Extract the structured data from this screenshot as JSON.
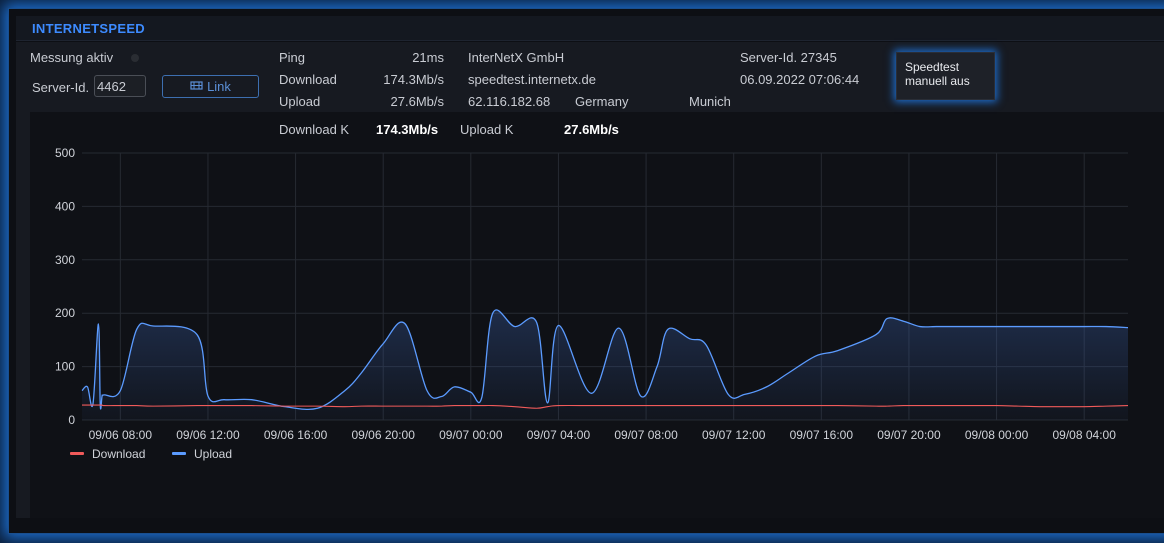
{
  "header": {
    "title": "INTERNETSPEED"
  },
  "controls": {
    "measurement_label": "Messung aktiv",
    "server_id_label": "Server-Id.",
    "server_id_value": "4462",
    "link_label": "Link",
    "speedtest_button": "Speedtest manuell aus"
  },
  "stats": {
    "ping_label": "Ping",
    "ping_value": "21ms",
    "download_label": "Download",
    "download_value": "174.3Mb/s",
    "upload_label": "Upload",
    "upload_value": "27.6Mb/s",
    "download_k_label": "Download K",
    "download_k_value": "174.3Mb/s",
    "upload_k_label": "Upload K",
    "upload_k_value": "27.6Mb/s"
  },
  "server_info": {
    "provider": "InterNetX GmbH",
    "host": "speedtest.internetx.de",
    "ip": "62.116.182.68",
    "country": "Germany",
    "city": "Munich",
    "server_id": "Server-Id. 27345",
    "timestamp": "06.09.2022 07:06:44"
  },
  "colors": {
    "accent": "#3d8bff",
    "download": "#f05a5a",
    "upload": "#5b9bff"
  },
  "chart_data": {
    "type": "area",
    "x": [
      "09/06 06:15",
      "09/06 06:30",
      "09/06 06:45",
      "09/06 07:00",
      "09/06 07:05",
      "09/06 07:10",
      "09/06 07:15",
      "09/06 08:00",
      "09/06 08:45",
      "09/06 09:30",
      "09/06 11:30",
      "09/06 12:00",
      "09/06 12:45",
      "09/06 14:00",
      "09/06 15:30",
      "09/06 17:00",
      "09/06 18:15",
      "09/06 19:00",
      "09/06 20:00",
      "09/06 21:00",
      "09/06 22:00",
      "09/06 22:40",
      "09/06 23:15",
      "09/07 00:00",
      "09/07 00:30",
      "09/07 01:00",
      "09/07 02:00",
      "09/07 03:00",
      "09/07 03:30",
      "09/07 04:00",
      "09/07 05:30",
      "09/07 06:45",
      "09/07 07:45",
      "09/07 08:30",
      "09/07 09:00",
      "09/07 10:00",
      "09/07 10:45",
      "09/07 11:45",
      "09/07 12:30",
      "09/07 13:30",
      "09/07 14:30",
      "09/07 15:45",
      "09/07 16:45",
      "09/07 18:30",
      "09/07 19:00",
      "09/07 19:45",
      "09/07 20:30",
      "09/07 21:15",
      "09/07 22:00",
      "09/07 23:00",
      "09/08 00:00",
      "09/08 01:00",
      "09/08 02:00",
      "09/08 03:00",
      "09/08 04:00",
      "09/08 05:00",
      "09/08 06:00"
    ],
    "series": [
      {
        "name": "Download",
        "values": [
          28,
          28,
          28,
          28,
          28,
          28,
          27,
          27,
          27,
          26,
          27,
          27,
          27,
          27,
          26,
          26,
          25,
          26,
          26,
          26,
          26,
          26,
          27,
          27,
          27,
          27,
          25,
          22,
          25,
          27,
          27,
          27,
          27,
          27,
          27,
          27,
          27,
          27,
          27,
          27,
          27,
          27,
          27,
          26,
          26,
          27,
          27,
          27,
          27,
          27,
          27,
          26,
          25,
          25,
          25,
          26,
          27
        ]
      },
      {
        "name": "Upload",
        "values": [
          55,
          62,
          30,
          180,
          28,
          45,
          47,
          55,
          170,
          176,
          160,
          45,
          38,
          38,
          25,
          22,
          55,
          88,
          143,
          180,
          55,
          44,
          62,
          52,
          42,
          200,
          175,
          183,
          32,
          177,
          50,
          172,
          45,
          100,
          170,
          152,
          140,
          48,
          48,
          62,
          88,
          120,
          130,
          160,
          190,
          185,
          175,
          175,
          175,
          175,
          175,
          175,
          175,
          175,
          175,
          175,
          173
        ]
      }
    ],
    "ylim": [
      0,
      500
    ],
    "yticks": [
      0,
      100,
      200,
      300,
      400,
      500
    ],
    "xticks": [
      "09/06 08:00",
      "09/06 12:00",
      "09/06 16:00",
      "09/06 20:00",
      "09/07 00:00",
      "09/07 04:00",
      "09/07 08:00",
      "09/07 12:00",
      "09/07 16:00",
      "09/07 20:00",
      "09/08 00:00",
      "09/08 04:00"
    ],
    "grid": true,
    "legend": "bottom-left"
  }
}
